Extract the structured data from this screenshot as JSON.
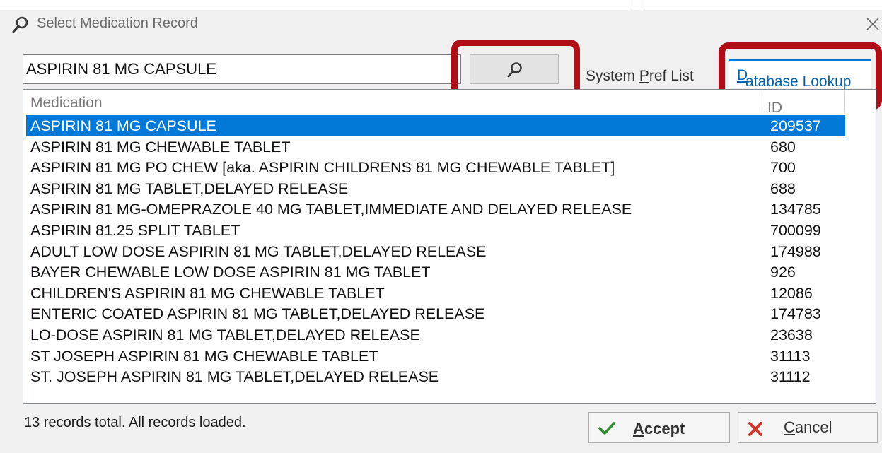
{
  "window": {
    "title": "Select Medication Record",
    "title_icon": "search-icon",
    "close_icon": "close-icon"
  },
  "search": {
    "value": "ASPIRIN 81 MG CAPSULE",
    "button_icon": "search-icon"
  },
  "tabs": [
    {
      "pre": "System ",
      "accel": "P",
      "post": "ref List",
      "active": false
    },
    {
      "pre": "",
      "accel": "D",
      "post": "atabase Lookup",
      "active": true
    }
  ],
  "table": {
    "columns": [
      "Medication",
      "ID"
    ],
    "rows": [
      {
        "medication": "ASPIRIN 81 MG CAPSULE",
        "id": "209537",
        "selected": true
      },
      {
        "medication": "ASPIRIN 81 MG CHEWABLE TABLET",
        "id": "680"
      },
      {
        "medication": "ASPIRIN 81 MG PO CHEW [aka. ASPIRIN CHILDRENS 81 MG CHEWABLE TABLET]",
        "id": "700"
      },
      {
        "medication": "ASPIRIN 81 MG TABLET,DELAYED RELEASE",
        "id": "688"
      },
      {
        "medication": "ASPIRIN 81 MG-OMEPRAZOLE 40 MG TABLET,IMMEDIATE AND DELAYED RELEASE",
        "id": "134785"
      },
      {
        "medication": "ASPIRIN 81.25 SPLIT TABLET",
        "id": "700099"
      },
      {
        "medication": "ADULT LOW DOSE ASPIRIN 81 MG TABLET,DELAYED RELEASE",
        "id": "174988"
      },
      {
        "medication": "BAYER CHEWABLE LOW DOSE ASPIRIN 81 MG TABLET",
        "id": "926"
      },
      {
        "medication": "CHILDREN'S ASPIRIN 81 MG CHEWABLE TABLET",
        "id": "12086"
      },
      {
        "medication": "ENTERIC COATED ASPIRIN 81 MG TABLET,DELAYED RELEASE",
        "id": "174783"
      },
      {
        "medication": "LO-DOSE ASPIRIN 81 MG TABLET,DELAYED RELEASE",
        "id": "23638"
      },
      {
        "medication": "ST JOSEPH ASPIRIN 81 MG CHEWABLE TABLET",
        "id": "31113"
      },
      {
        "medication": "ST. JOSEPH ASPIRIN 81 MG TABLET,DELAYED RELEASE",
        "id": "31112"
      }
    ]
  },
  "status": "13 records total. All records loaded.",
  "buttons": {
    "accept": {
      "accel": "A",
      "rest": "ccept",
      "icon": "checkmark-icon",
      "icon_color": "#2e8b2e"
    },
    "cancel": {
      "accel": "C",
      "rest": "ancel",
      "icon": "x-mark-icon",
      "icon_color": "#d4362c"
    }
  },
  "colors": {
    "selection": "#0078d7",
    "highlight_box": "#b10d16",
    "tab_text": "#0063b1"
  }
}
